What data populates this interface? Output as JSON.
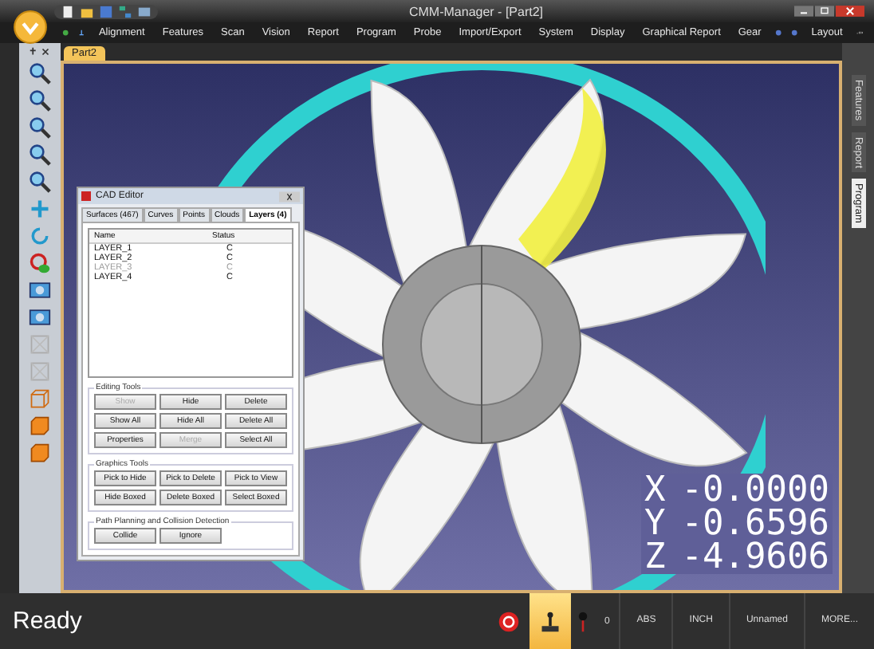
{
  "window": {
    "title": "CMM-Manager - [Part2]"
  },
  "menu": [
    {
      "label": "Alignment"
    },
    {
      "label": "Features"
    },
    {
      "label": "Scan"
    },
    {
      "label": "Vision"
    },
    {
      "label": "Report"
    },
    {
      "label": "Program"
    },
    {
      "label": "Probe"
    },
    {
      "label": "Import/Export"
    },
    {
      "label": "System"
    },
    {
      "label": "Display"
    },
    {
      "label": "Graphical Report"
    },
    {
      "label": "Gear"
    }
  ],
  "layout_menu": "Layout",
  "document_tabs": [
    {
      "label": "Part2",
      "selected": true
    }
  ],
  "side_tabs": [
    {
      "label": "Features",
      "selected": false
    },
    {
      "label": "Report",
      "selected": false
    },
    {
      "label": "Program",
      "selected": true
    }
  ],
  "cad_editor": {
    "title": "CAD Editor",
    "tabs": [
      {
        "label": "Surfaces (467)",
        "selected": false
      },
      {
        "label": "Curves",
        "selected": false
      },
      {
        "label": "Points",
        "selected": false
      },
      {
        "label": "Clouds",
        "selected": false
      },
      {
        "label": "Layers (4)",
        "selected": true
      }
    ],
    "columns": [
      "Name",
      "Status"
    ],
    "rows": [
      {
        "name": "LAYER_1",
        "status": "C",
        "disabled": false
      },
      {
        "name": "LAYER_2",
        "status": "C",
        "disabled": false
      },
      {
        "name": "LAYER_3",
        "status": "C",
        "disabled": true
      },
      {
        "name": "LAYER_4",
        "status": "C",
        "disabled": false
      }
    ],
    "groups": [
      {
        "title": "Editing Tools",
        "buttons": [
          {
            "label": "Show",
            "disabled": true
          },
          {
            "label": "Hide",
            "disabled": false
          },
          {
            "label": "Delete",
            "disabled": false
          },
          {
            "label": "Show All",
            "disabled": false
          },
          {
            "label": "Hide All",
            "disabled": false
          },
          {
            "label": "Delete All",
            "disabled": false
          },
          {
            "label": "Properties",
            "disabled": false
          },
          {
            "label": "Merge",
            "disabled": true
          },
          {
            "label": "Select All",
            "disabled": false
          }
        ]
      },
      {
        "title": "Graphics Tools",
        "buttons": [
          {
            "label": "Pick to Hide",
            "disabled": false
          },
          {
            "label": "Pick to Delete",
            "disabled": false
          },
          {
            "label": "Pick to View",
            "disabled": false
          },
          {
            "label": "Hide Boxed",
            "disabled": false
          },
          {
            "label": "Delete Boxed",
            "disabled": false
          },
          {
            "label": "Select Boxed",
            "disabled": false
          }
        ]
      },
      {
        "title": "Path Planning and Collision Detection",
        "buttons": [
          {
            "label": "Collide",
            "disabled": false
          },
          {
            "label": "Ignore",
            "disabled": false
          }
        ]
      }
    ]
  },
  "readout": [
    {
      "axis": "X",
      "value": "-0.0000"
    },
    {
      "axis": "Y",
      "value": "-0.6596"
    },
    {
      "axis": "Z",
      "value": "-4.9606"
    }
  ],
  "status_bar": {
    "text": "Ready",
    "count": "0",
    "mode": "ABS",
    "units": "INCH",
    "name": "Unnamed",
    "more": "MORE..."
  }
}
